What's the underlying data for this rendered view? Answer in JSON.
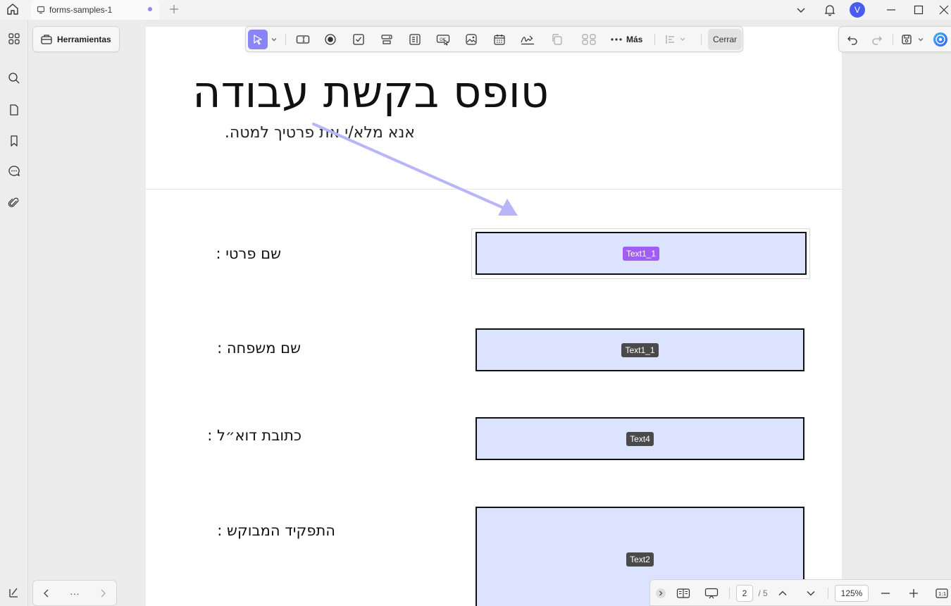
{
  "titlebar": {
    "tab_title": "forms-samples-1",
    "avatar_letter": "V"
  },
  "left_panel": {
    "tools_label": "Herramientas",
    "pager_more": "···"
  },
  "toolbar": {
    "more_label": "Más",
    "close_label": "Cerrar"
  },
  "document": {
    "title": "טופס בקשת עבודה",
    "subtitle": "אנא מלא/י את פרטיך למטה.",
    "fields": [
      {
        "label": "שם  פרטי :",
        "tag": "Text1_1"
      },
      {
        "label": "שם  משפחה :",
        "tag": "Text1_1"
      },
      {
        "label": "כתובת  דוא״ל :",
        "tag": "Text4"
      },
      {
        "label": "התפקיד המבוקש :",
        "tag": "Text2"
      }
    ]
  },
  "bottombar": {
    "current_page": "2",
    "total_pages": "/ 5",
    "zoom": "125%"
  },
  "colors": {
    "accent": "#8a85f6",
    "field_fill": "#dce3fe",
    "active_tag": "#a15cf2",
    "arrow": "#b9b5fb"
  }
}
